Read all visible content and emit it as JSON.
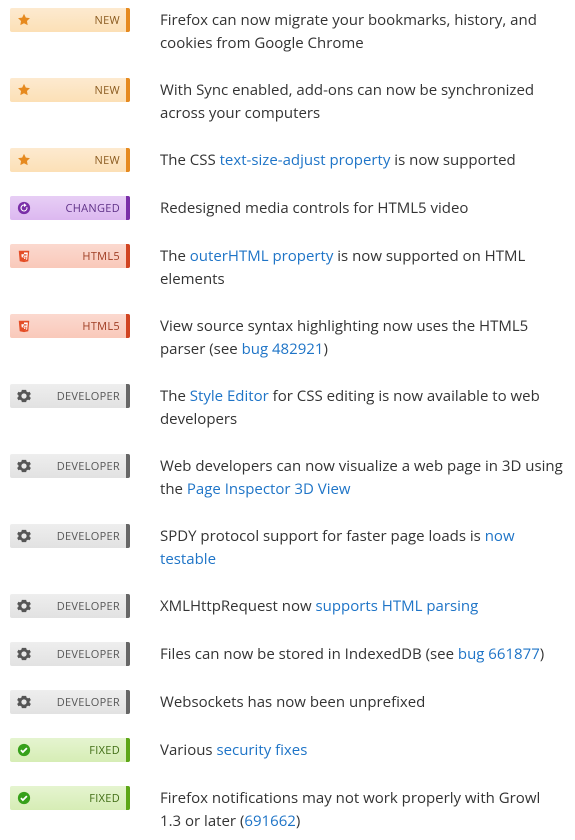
{
  "badge_labels": {
    "new": "NEW",
    "changed": "CHANGED",
    "html5": "HTML5",
    "developer": "DEVELOPER",
    "fixed": "FIXED"
  },
  "items": [
    {
      "type": "new",
      "parts": [
        {
          "kind": "text",
          "value": "Firefox can now migrate your bookmarks, history, and cookies from Google Chrome"
        }
      ]
    },
    {
      "type": "new",
      "parts": [
        {
          "kind": "text",
          "value": "With Sync enabled, add-ons can now be synchronized across your computers"
        }
      ]
    },
    {
      "type": "new",
      "parts": [
        {
          "kind": "text",
          "value": "The CSS "
        },
        {
          "kind": "link",
          "value": "text-size-adjust property"
        },
        {
          "kind": "text",
          "value": " is now supported"
        }
      ]
    },
    {
      "type": "changed",
      "parts": [
        {
          "kind": "text",
          "value": "Redesigned media controls for HTML5 video"
        }
      ]
    },
    {
      "type": "html5",
      "parts": [
        {
          "kind": "text",
          "value": "The "
        },
        {
          "kind": "link",
          "value": "outerHTML property"
        },
        {
          "kind": "text",
          "value": " is now supported on HTML elements"
        }
      ]
    },
    {
      "type": "html5",
      "parts": [
        {
          "kind": "text",
          "value": "View source syntax highlighting now uses the HTML5 parser (see "
        },
        {
          "kind": "link",
          "value": "bug 482921"
        },
        {
          "kind": "text",
          "value": ")"
        }
      ]
    },
    {
      "type": "developer",
      "parts": [
        {
          "kind": "text",
          "value": "The "
        },
        {
          "kind": "link",
          "value": "Style Editor"
        },
        {
          "kind": "text",
          "value": " for CSS editing is now available to web developers"
        }
      ]
    },
    {
      "type": "developer",
      "parts": [
        {
          "kind": "text",
          "value": "Web developers can now visualize a web page in 3D using the "
        },
        {
          "kind": "link",
          "value": "Page Inspector 3D View"
        }
      ]
    },
    {
      "type": "developer",
      "parts": [
        {
          "kind": "text",
          "value": "SPDY protocol support for faster page loads is "
        },
        {
          "kind": "link",
          "value": "now testable"
        }
      ]
    },
    {
      "type": "developer",
      "parts": [
        {
          "kind": "text",
          "value": "XMLHttpRequest now "
        },
        {
          "kind": "link",
          "value": "supports HTML parsing"
        }
      ]
    },
    {
      "type": "developer",
      "parts": [
        {
          "kind": "text",
          "value": "Files can now be stored in IndexedDB (see "
        },
        {
          "kind": "link",
          "value": "bug 661877"
        },
        {
          "kind": "text",
          "value": ")"
        }
      ]
    },
    {
      "type": "developer",
      "parts": [
        {
          "kind": "text",
          "value": "Websockets has now been unprefixed"
        }
      ]
    },
    {
      "type": "fixed",
      "parts": [
        {
          "kind": "text",
          "value": "Various "
        },
        {
          "kind": "link",
          "value": "security fixes"
        }
      ]
    },
    {
      "type": "fixed",
      "parts": [
        {
          "kind": "text",
          "value": "Firefox notifications may not work properly with Growl 1.3 or later ("
        },
        {
          "kind": "link",
          "value": "691662"
        },
        {
          "kind": "text",
          "value": ")"
        }
      ]
    }
  ]
}
